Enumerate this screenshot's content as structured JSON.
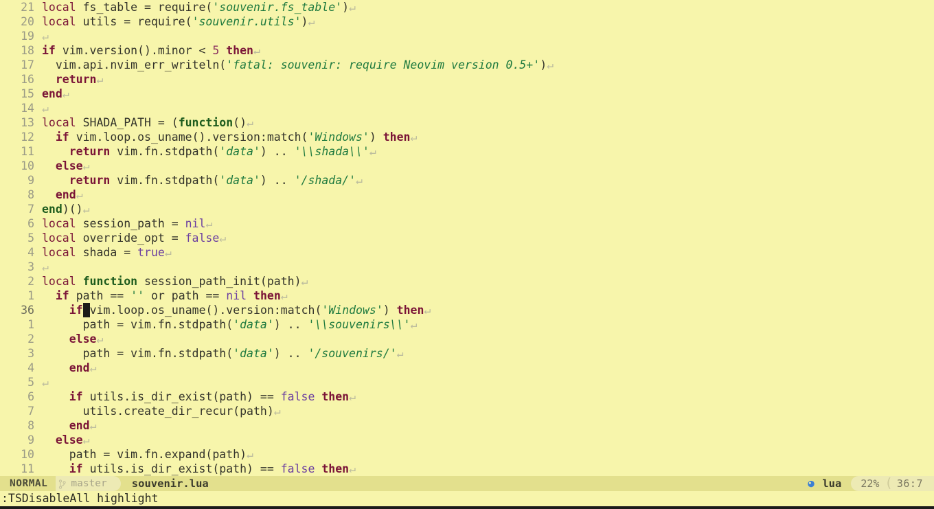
{
  "editor": {
    "filetype_label": "lua",
    "lines": [
      {
        "num": "21",
        "abs": false,
        "tokens": [
          {
            "t": "local ",
            "c": "kwlocal"
          },
          {
            "t": "fs_table = require(",
            "c": "ident"
          },
          {
            "t": "'souvenir.fs_table'",
            "c": "str"
          },
          {
            "t": ")",
            "c": "punct"
          },
          {
            "t": "↵",
            "c": "eol"
          }
        ]
      },
      {
        "num": "20",
        "abs": false,
        "tokens": [
          {
            "t": "local ",
            "c": "kwlocal"
          },
          {
            "t": "utils = require(",
            "c": "ident"
          },
          {
            "t": "'souvenir.utils'",
            "c": "str"
          },
          {
            "t": ")",
            "c": "punct"
          },
          {
            "t": "↵",
            "c": "eol"
          }
        ]
      },
      {
        "num": "19",
        "abs": false,
        "tokens": [
          {
            "t": "↵",
            "c": "eol"
          }
        ]
      },
      {
        "num": "18",
        "abs": false,
        "tokens": [
          {
            "t": "if ",
            "c": "kw"
          },
          {
            "t": "vim.version().minor < ",
            "c": "ident"
          },
          {
            "t": "5",
            "c": "num-lit"
          },
          {
            "t": " ",
            "c": "ident"
          },
          {
            "t": "then",
            "c": "kw"
          },
          {
            "t": "↵",
            "c": "eol"
          }
        ]
      },
      {
        "num": "17",
        "abs": false,
        "tokens": [
          {
            "t": "  vim.api.nvim_err_writeln(",
            "c": "ident"
          },
          {
            "t": "'fatal: souvenir: require Neovim version 0.5+'",
            "c": "str"
          },
          {
            "t": ")",
            "c": "punct"
          },
          {
            "t": "↵",
            "c": "eol"
          }
        ]
      },
      {
        "num": "16",
        "abs": false,
        "tokens": [
          {
            "t": "  ",
            "c": "ident"
          },
          {
            "t": "return",
            "c": "kw"
          },
          {
            "t": "↵",
            "c": "eol"
          }
        ]
      },
      {
        "num": "15",
        "abs": false,
        "tokens": [
          {
            "t": "end",
            "c": "kw"
          },
          {
            "t": "↵",
            "c": "eol"
          }
        ]
      },
      {
        "num": "14",
        "abs": false,
        "tokens": [
          {
            "t": "↵",
            "c": "eol"
          }
        ]
      },
      {
        "num": "13",
        "abs": false,
        "tokens": [
          {
            "t": "local ",
            "c": "kwlocal"
          },
          {
            "t": "SHADA_PATH = (",
            "c": "ident"
          },
          {
            "t": "function",
            "c": "kwfn"
          },
          {
            "t": "()",
            "c": "punct"
          },
          {
            "t": "↵",
            "c": "eol"
          }
        ]
      },
      {
        "num": "12",
        "abs": false,
        "tokens": [
          {
            "t": "  ",
            "c": "ident"
          },
          {
            "t": "if ",
            "c": "kw"
          },
          {
            "t": "vim.loop.os_uname().version:match(",
            "c": "ident"
          },
          {
            "t": "'Windows'",
            "c": "str"
          },
          {
            "t": ") ",
            "c": "punct"
          },
          {
            "t": "then",
            "c": "kw"
          },
          {
            "t": "↵",
            "c": "eol"
          }
        ]
      },
      {
        "num": "11",
        "abs": false,
        "tokens": [
          {
            "t": "    ",
            "c": "ident"
          },
          {
            "t": "return ",
            "c": "kw"
          },
          {
            "t": "vim.fn.stdpath(",
            "c": "ident"
          },
          {
            "t": "'data'",
            "c": "str"
          },
          {
            "t": ") .. ",
            "c": "punct"
          },
          {
            "t": "'\\\\shada\\\\'",
            "c": "str"
          },
          {
            "t": "↵",
            "c": "eol"
          }
        ]
      },
      {
        "num": "10",
        "abs": false,
        "tokens": [
          {
            "t": "  ",
            "c": "ident"
          },
          {
            "t": "else",
            "c": "kw"
          },
          {
            "t": "↵",
            "c": "eol"
          }
        ]
      },
      {
        "num": "9",
        "abs": false,
        "tokens": [
          {
            "t": "    ",
            "c": "ident"
          },
          {
            "t": "return ",
            "c": "kw"
          },
          {
            "t": "vim.fn.stdpath(",
            "c": "ident"
          },
          {
            "t": "'data'",
            "c": "str"
          },
          {
            "t": ") .. ",
            "c": "punct"
          },
          {
            "t": "'/shada/'",
            "c": "str"
          },
          {
            "t": "↵",
            "c": "eol"
          }
        ]
      },
      {
        "num": "8",
        "abs": false,
        "tokens": [
          {
            "t": "  ",
            "c": "ident"
          },
          {
            "t": "end",
            "c": "kw"
          },
          {
            "t": "↵",
            "c": "eol"
          }
        ]
      },
      {
        "num": "7",
        "abs": false,
        "tokens": [
          {
            "t": "end",
            "c": "kwfn"
          },
          {
            "t": ")()",
            "c": "punct"
          },
          {
            "t": "↵",
            "c": "eol"
          }
        ]
      },
      {
        "num": "6",
        "abs": false,
        "tokens": [
          {
            "t": "local ",
            "c": "kwlocal"
          },
          {
            "t": "session_path = ",
            "c": "ident"
          },
          {
            "t": "nil",
            "c": "const"
          },
          {
            "t": "↵",
            "c": "eol"
          }
        ]
      },
      {
        "num": "5",
        "abs": false,
        "tokens": [
          {
            "t": "local ",
            "c": "kwlocal"
          },
          {
            "t": "override_opt = ",
            "c": "ident"
          },
          {
            "t": "false",
            "c": "const"
          },
          {
            "t": "↵",
            "c": "eol"
          }
        ]
      },
      {
        "num": "4",
        "abs": false,
        "tokens": [
          {
            "t": "local ",
            "c": "kwlocal"
          },
          {
            "t": "shada = ",
            "c": "ident"
          },
          {
            "t": "true",
            "c": "const"
          },
          {
            "t": "↵",
            "c": "eol"
          }
        ]
      },
      {
        "num": "3",
        "abs": false,
        "tokens": [
          {
            "t": "↵",
            "c": "eol"
          }
        ]
      },
      {
        "num": "2",
        "abs": false,
        "tokens": [
          {
            "t": "local ",
            "c": "kwlocal"
          },
          {
            "t": "function",
            "c": "kwfn"
          },
          {
            "t": " session_path_init(path)",
            "c": "ident"
          },
          {
            "t": "↵",
            "c": "eol"
          }
        ]
      },
      {
        "num": "1",
        "abs": false,
        "tokens": [
          {
            "t": "  ",
            "c": "ident"
          },
          {
            "t": "if ",
            "c": "kw"
          },
          {
            "t": "path == ",
            "c": "ident"
          },
          {
            "t": "''",
            "c": "str"
          },
          {
            "t": " or path == ",
            "c": "ident"
          },
          {
            "t": "nil",
            "c": "const"
          },
          {
            "t": " ",
            "c": "ident"
          },
          {
            "t": "then",
            "c": "kw"
          },
          {
            "t": "↵",
            "c": "eol"
          }
        ]
      },
      {
        "num": "36",
        "abs": true,
        "cursor_after": 2,
        "tokens": [
          {
            "t": "    ",
            "c": "ident"
          },
          {
            "t": "if",
            "c": "kw"
          },
          {
            "t": "CURSOR",
            "c": "cursor"
          },
          {
            "t": "vim.loop.os_uname().version:match(",
            "c": "ident"
          },
          {
            "t": "'Windows'",
            "c": "str"
          },
          {
            "t": ") ",
            "c": "punct"
          },
          {
            "t": "then",
            "c": "kw"
          },
          {
            "t": "↵",
            "c": "eol"
          }
        ]
      },
      {
        "num": "1",
        "abs": false,
        "tokens": [
          {
            "t": "      path = vim.fn.stdpath(",
            "c": "ident"
          },
          {
            "t": "'data'",
            "c": "str"
          },
          {
            "t": ") .. ",
            "c": "punct"
          },
          {
            "t": "'\\\\souvenirs\\\\'",
            "c": "str"
          },
          {
            "t": "↵",
            "c": "eol"
          }
        ]
      },
      {
        "num": "2",
        "abs": false,
        "tokens": [
          {
            "t": "    ",
            "c": "ident"
          },
          {
            "t": "else",
            "c": "kw"
          },
          {
            "t": "↵",
            "c": "eol"
          }
        ]
      },
      {
        "num": "3",
        "abs": false,
        "tokens": [
          {
            "t": "      path = vim.fn.stdpath(",
            "c": "ident"
          },
          {
            "t": "'data'",
            "c": "str"
          },
          {
            "t": ") .. ",
            "c": "punct"
          },
          {
            "t": "'/souvenirs/'",
            "c": "str"
          },
          {
            "t": "↵",
            "c": "eol"
          }
        ]
      },
      {
        "num": "4",
        "abs": false,
        "tokens": [
          {
            "t": "    ",
            "c": "ident"
          },
          {
            "t": "end",
            "c": "kw"
          },
          {
            "t": "↵",
            "c": "eol"
          }
        ]
      },
      {
        "num": "5",
        "abs": false,
        "tokens": [
          {
            "t": "↵",
            "c": "eol"
          }
        ]
      },
      {
        "num": "6",
        "abs": false,
        "tokens": [
          {
            "t": "    ",
            "c": "ident"
          },
          {
            "t": "if ",
            "c": "kw"
          },
          {
            "t": "utils.is_dir_exist(path) == ",
            "c": "ident"
          },
          {
            "t": "false",
            "c": "const"
          },
          {
            "t": " ",
            "c": "ident"
          },
          {
            "t": "then",
            "c": "kw"
          },
          {
            "t": "↵",
            "c": "eol"
          }
        ]
      },
      {
        "num": "7",
        "abs": false,
        "tokens": [
          {
            "t": "      utils.create_dir_recur(path)",
            "c": "ident"
          },
          {
            "t": "↵",
            "c": "eol"
          }
        ]
      },
      {
        "num": "8",
        "abs": false,
        "tokens": [
          {
            "t": "    ",
            "c": "ident"
          },
          {
            "t": "end",
            "c": "kw"
          },
          {
            "t": "↵",
            "c": "eol"
          }
        ]
      },
      {
        "num": "9",
        "abs": false,
        "tokens": [
          {
            "t": "  ",
            "c": "ident"
          },
          {
            "t": "else",
            "c": "kw"
          },
          {
            "t": "↵",
            "c": "eol"
          }
        ]
      },
      {
        "num": "10",
        "abs": false,
        "tokens": [
          {
            "t": "    path = vim.fn.expand(path)",
            "c": "ident"
          },
          {
            "t": "↵",
            "c": "eol"
          }
        ]
      },
      {
        "num": "11",
        "abs": false,
        "tokens": [
          {
            "t": "    ",
            "c": "ident"
          },
          {
            "t": "if ",
            "c": "kw"
          },
          {
            "t": "utils.is_dir_exist(path) == ",
            "c": "ident"
          },
          {
            "t": "false",
            "c": "const"
          },
          {
            "t": " ",
            "c": "ident"
          },
          {
            "t": "then",
            "c": "kw"
          },
          {
            "t": "↵",
            "c": "eol"
          }
        ]
      }
    ]
  },
  "statusline": {
    "mode": "NORMAL",
    "branch_icon": "git-branch-icon",
    "branch": "master",
    "filename": "souvenir.lua",
    "filetype_icon": "lua-icon",
    "filetype": "lua",
    "percent": "22%",
    "separator": "(",
    "position": "36:7"
  },
  "cmdline": {
    "text": ":TSDisableAll highlight"
  },
  "colors": {
    "background": "#f7f5ab",
    "foreground": "#33332a",
    "keyword": "#7a1437",
    "function": "#1d5b1d",
    "string": "#1f7a3f",
    "constant": "#6b3fa0",
    "linenr": "#9a9a86",
    "cursorlinenr": "#6b6b5b",
    "cursor": "#1d1d1a",
    "statusline_bg": "#e3e08d",
    "statusline_alt_bg": "#edeab4"
  }
}
